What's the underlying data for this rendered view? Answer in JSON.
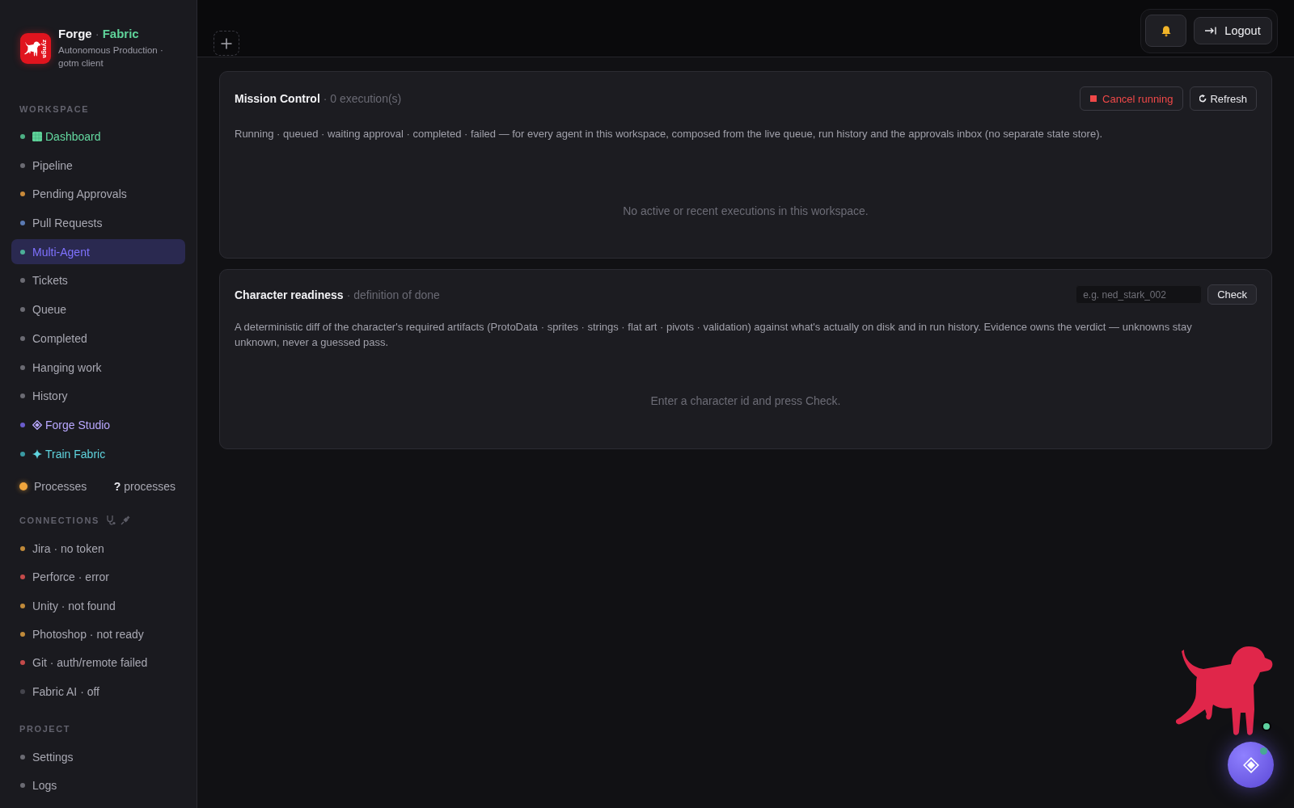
{
  "brand": {
    "logo_text": "zynga",
    "title": "Forge",
    "separator": "·",
    "title_accent": "Fabric",
    "subtitle": "Autonomous Production · gotm client"
  },
  "workspace": {
    "heading": "WORKSPACE",
    "items": [
      {
        "label": "Dashboard",
        "kind": "home",
        "color": "#4caf84",
        "selected": false
      },
      {
        "label": "Pipeline",
        "kind": "plain",
        "color": "#6b6b73",
        "selected": false
      },
      {
        "label": "Pending Approvals",
        "kind": "plain",
        "color": "#c98a3a",
        "selected": false
      },
      {
        "label": "Pull Requests",
        "kind": "plain",
        "color": "#5b7ab3",
        "selected": false
      },
      {
        "label": "Multi-Agent",
        "kind": "plain",
        "color": "#4caf98",
        "selected": true
      },
      {
        "label": "Tickets",
        "kind": "plain",
        "color": "#6b6b73",
        "selected": false
      },
      {
        "label": "Queue",
        "kind": "plain",
        "color": "#6b6b73",
        "selected": false
      },
      {
        "label": "Completed",
        "kind": "plain",
        "color": "#6b6b73",
        "selected": false
      },
      {
        "label": "Hanging work",
        "kind": "plain",
        "color": "#6b6b73",
        "selected": false
      },
      {
        "label": "History",
        "kind": "plain",
        "color": "#6b6b73",
        "selected": false
      },
      {
        "label": "Forge Studio",
        "kind": "studio",
        "color": "#6a5ccc",
        "selected": false
      },
      {
        "label": "Train Fabric",
        "kind": "training",
        "color": "#3a9aa3",
        "selected": false
      }
    ]
  },
  "processes": {
    "label": "Processes",
    "count": "**?** processes"
  },
  "connections": {
    "heading": "CONNECTIONS",
    "items": [
      {
        "label": "Jira · no token",
        "color": "#c08a3a"
      },
      {
        "label": "Perforce · error",
        "color": "#c44a4a"
      },
      {
        "label": "Unity · not found",
        "color": "#c08a3a"
      },
      {
        "label": "Photoshop · not ready",
        "color": "#c08a3a"
      },
      {
        "label": "Git · auth/remote failed",
        "color": "#c44a4a"
      },
      {
        "label": "Fabric AI · off",
        "color": "#44444c"
      }
    ]
  },
  "project": {
    "heading": "PROJECT",
    "items": [
      {
        "label": "Settings",
        "color": "#6b6b73",
        "selected": false
      },
      {
        "label": "Logs",
        "color": "#6b6b73",
        "selected": false
      }
    ]
  },
  "topbar": {
    "logout": "Logout"
  },
  "mission_control": {
    "title": "Mission Control",
    "subtitle": "· 0 execution(s)",
    "buttons": [
      {
        "label": "Cancel running",
        "kind": "danger"
      },
      {
        "label": "Refresh",
        "kind": "refresh"
      }
    ],
    "description": "Running · queued · waiting approval · completed · failed — for every agent in this workspace, composed from the live queue, run history and the approvals inbox (no separate state store).",
    "empty": "No active or recent executions in this workspace."
  },
  "character_readiness": {
    "title": "Character readiness",
    "subtitle": "· definition of done",
    "placeholder": "e.g. ned_stark_002",
    "button": "Check",
    "description": "A deterministic diff of the character's required artifacts (ProtoData · sprites · strings · flat art · pivots · validation) against what's actually on disk and in run history. Evidence owns the verdict — unknowns stay unknown, never a guessed pass.",
    "empty": "Enter a character id and press Check."
  }
}
